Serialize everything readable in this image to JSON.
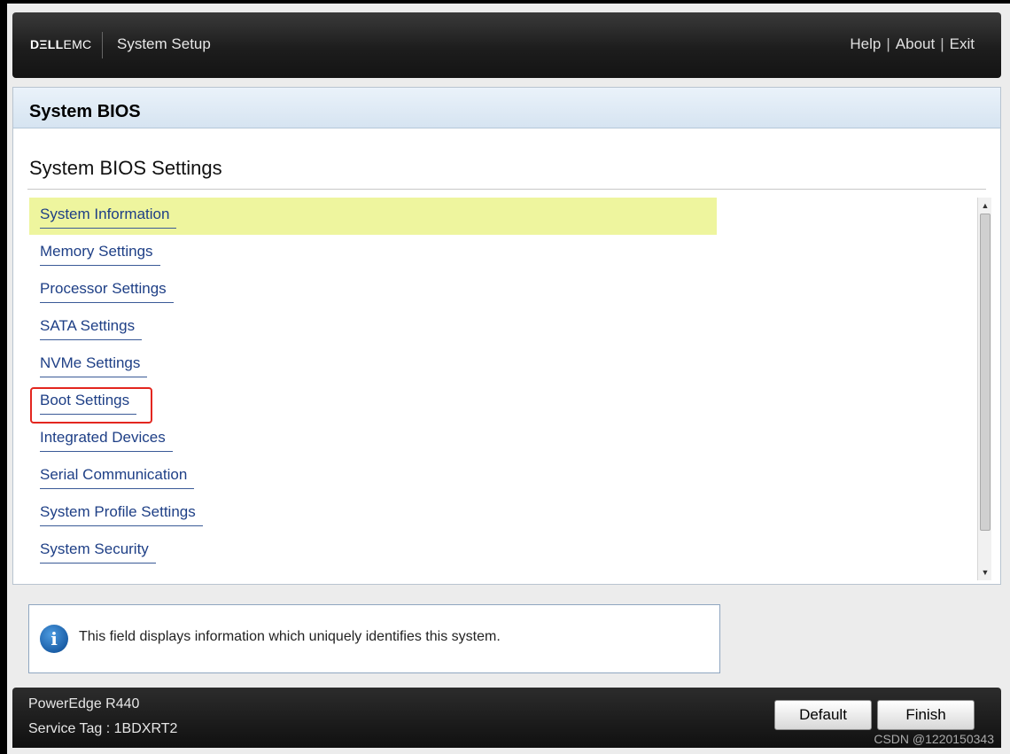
{
  "header": {
    "logo_dell": "DΞLL",
    "logo_emc": "EMC",
    "app_title": "System Setup",
    "links": [
      "Help",
      "About",
      "Exit"
    ],
    "separator": "|"
  },
  "panel": {
    "title": "System BIOS",
    "section_title": "System BIOS Settings",
    "menu_items": [
      {
        "label": "System Information",
        "selected": true
      },
      {
        "label": "Memory Settings"
      },
      {
        "label": "Processor Settings"
      },
      {
        "label": "SATA Settings"
      },
      {
        "label": "NVMe Settings"
      },
      {
        "label": "Boot Settings",
        "highlighted": true
      },
      {
        "label": "Integrated Devices"
      },
      {
        "label": "Serial Communication"
      },
      {
        "label": "System Profile Settings"
      },
      {
        "label": "System Security"
      }
    ],
    "scroll_up_icon": "▲",
    "scroll_down_icon": "▼"
  },
  "info": {
    "icon": "i",
    "text": "This field displays information which uniquely identifies this system."
  },
  "footer": {
    "model": "PowerEdge R440",
    "service_tag": "Service Tag : 1BDXRT2",
    "default_label": "Default",
    "finish_label": "Finish",
    "watermark": "CSDN @1220150343"
  },
  "colors": {
    "selected_bg": "#eef59e",
    "link_text": "#1e3f86",
    "highlight_border": "#e3261f"
  }
}
